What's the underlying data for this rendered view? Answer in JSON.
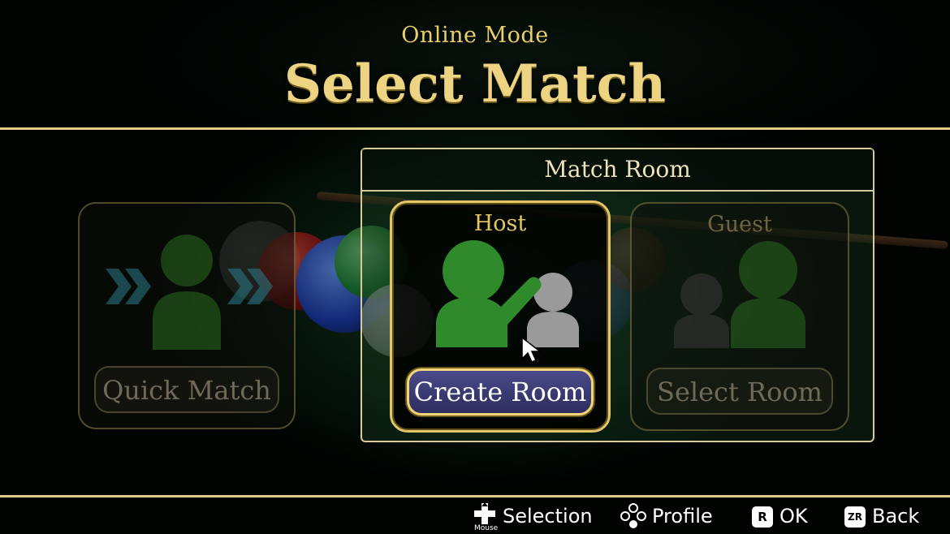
{
  "header": {
    "subtitle": "Online Mode",
    "title": "Select Match"
  },
  "quick_match": {
    "label": "Quick Match",
    "icon": "chevrons-person-icon"
  },
  "match_room": {
    "title": "Match Room",
    "host": {
      "label": "Host",
      "button": "Create Room",
      "icon": "host-raising-hand-icon"
    },
    "guest": {
      "label": "Guest",
      "button": "Select Room",
      "icon": "guest-pair-icon"
    }
  },
  "footer": {
    "selection": {
      "label": "Selection",
      "sub": "Mouse",
      "icon": "dpad-icon"
    },
    "profile": {
      "label": "Profile",
      "icon": "face-buttons-icon"
    },
    "ok": {
      "key": "R",
      "label": "OK"
    },
    "back": {
      "key": "ZR",
      "label": "Back"
    }
  },
  "colors": {
    "gold": "#e4c85d",
    "accent_green": "#2e8a2a",
    "button_blue": "#3a3a78"
  }
}
